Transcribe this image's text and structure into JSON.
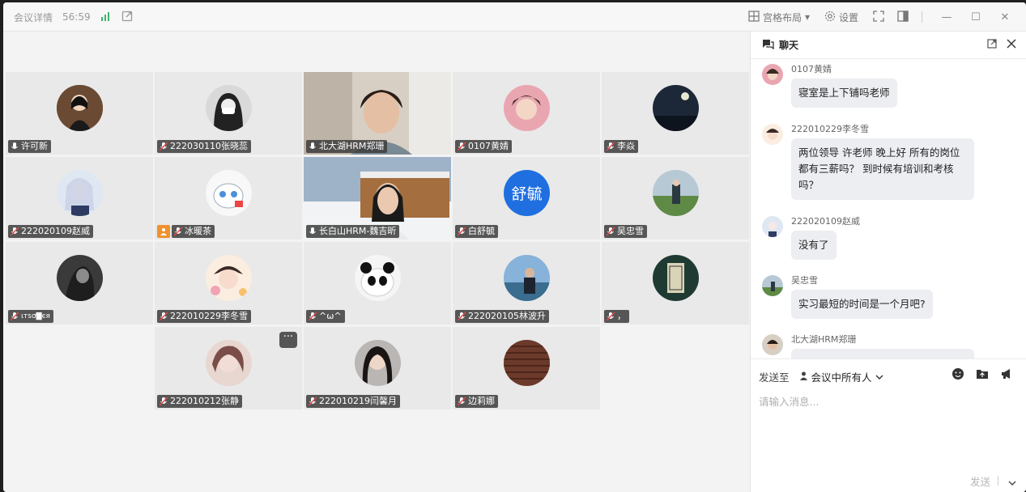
{
  "titlebar": {
    "title": "会议详情",
    "timer": "56:59",
    "layout_label": "宫格布局",
    "settings_label": "设置"
  },
  "tiles": [
    {
      "name": "许可新",
      "mic": "on"
    },
    {
      "name": "222030110张晓蕊",
      "mic": "off"
    },
    {
      "name": "北大湖HRM郑珊",
      "mic": "on",
      "video": true
    },
    {
      "name": "0107黄婧",
      "mic": "off"
    },
    {
      "name": "李焱",
      "mic": "off"
    },
    {
      "name": "222020109赵威",
      "mic": "off"
    },
    {
      "name": "冰暖茶",
      "mic": "off",
      "host": true
    },
    {
      "name": "长白山HRM-魏吉昕",
      "mic": "on",
      "video": true
    },
    {
      "name": "白舒毓",
      "mic": "off",
      "avatar_text": "舒毓"
    },
    {
      "name": "吴忠雪",
      "mic": "off"
    },
    {
      "name": "ιтsσ▇єя",
      "mic": "off"
    },
    {
      "name": "222010229李冬雪",
      "mic": "off"
    },
    {
      "name": "^ω^",
      "mic": "off"
    },
    {
      "name": "222020105林波升",
      "mic": "off"
    },
    {
      "name": "，",
      "mic": "off"
    },
    {
      "name": "222010212张静",
      "mic": "off"
    },
    {
      "name": "222010219闫馨月",
      "mic": "off"
    },
    {
      "name": "边莉娜",
      "mic": "off"
    }
  ],
  "colors": {
    "accent": "#1f6fe0",
    "shuyu_avatar": "#1f6fe0",
    "host_badge": "#f0922e",
    "namebar": "#3c3c3c"
  },
  "chat": {
    "title": "聊天",
    "messages": [
      {
        "sender": "0107黄婧",
        "text": "寝室是上下铺吗老师"
      },
      {
        "sender": "222010229李冬雪",
        "text": "两位领导 许老师 晚上好 所有的岗位都有三薪吗？ 到时候有培训和考核吗？"
      },
      {
        "sender": "222020109赵威",
        "text": "没有了"
      },
      {
        "sender": "吴忠雪",
        "text": "实习最短的时间是一个月吧?"
      },
      {
        "sender": "北大湖HRM郑珊",
        "text": ""
      }
    ],
    "send_to_label": "发送至",
    "send_to_target": "会议中所有人",
    "placeholder": "请输入消息...",
    "send_label": "发送"
  }
}
